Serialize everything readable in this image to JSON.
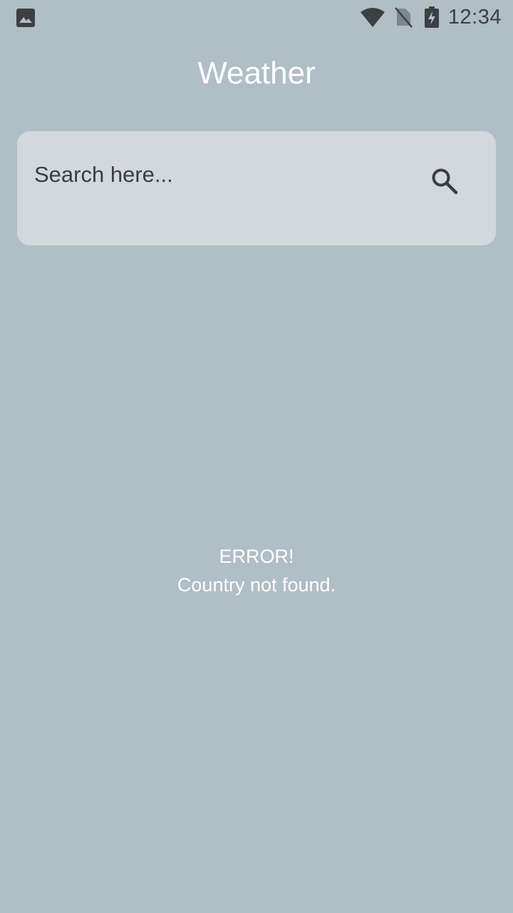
{
  "status_bar": {
    "left_icon": "image-icon",
    "icons": [
      "wifi-icon",
      "no-sim-icon",
      "battery-charging-icon"
    ],
    "time": "12:34"
  },
  "app": {
    "title": "Weather"
  },
  "search": {
    "value": "",
    "placeholder": "Search here...",
    "button_icon": "search-icon"
  },
  "message": {
    "heading": "ERROR!",
    "body": "Country not found."
  },
  "colors": {
    "background": "#b0bec5",
    "card": "#d2d8dc",
    "text_dark": "#3a3d42",
    "text_light": "#ffffff"
  }
}
